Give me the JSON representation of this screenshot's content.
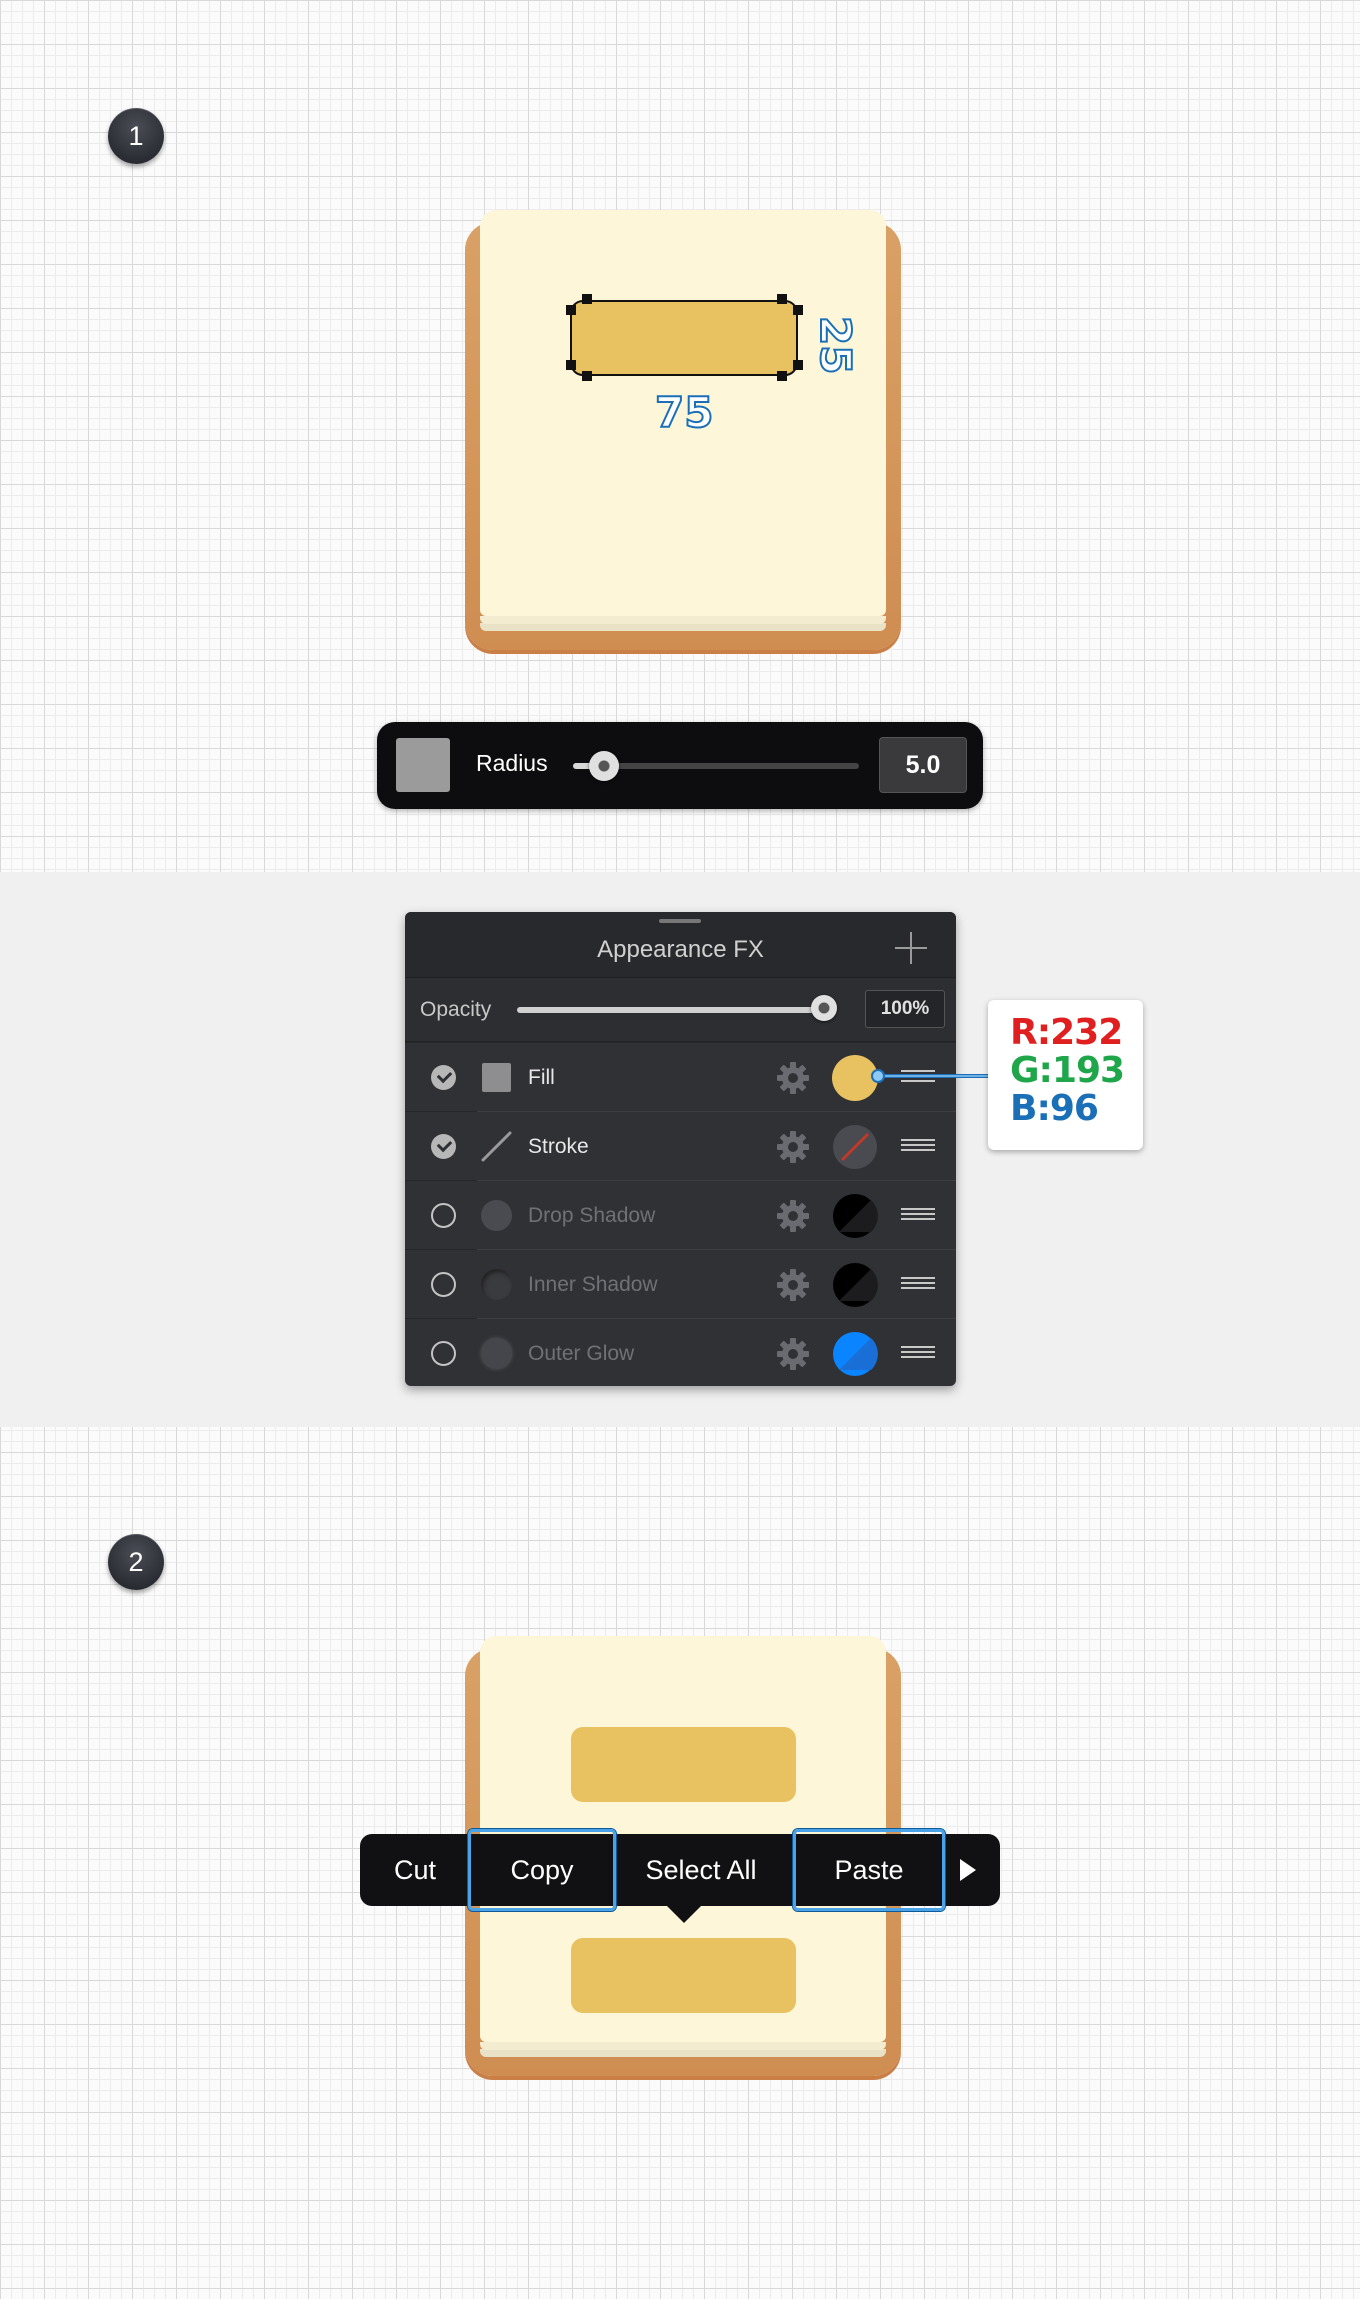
{
  "steps": [
    "1",
    "2"
  ],
  "dimensions": {
    "width": "75",
    "height": "25"
  },
  "radius_toolbar": {
    "label": "Radius",
    "value": "5.0",
    "slider_fraction": 0.08
  },
  "appearance_panel": {
    "title": "Appearance FX",
    "opacity_label": "Opacity",
    "opacity_value": "100%",
    "opacity_fraction": 1.0,
    "effects": [
      {
        "label": "Fill",
        "enabled": true,
        "color": "#e8c160"
      },
      {
        "label": "Stroke",
        "enabled": true,
        "color": "none"
      },
      {
        "label": "Drop Shadow",
        "enabled": false,
        "color": "#000000"
      },
      {
        "label": "Inner Shadow",
        "enabled": false,
        "color": "#000000"
      },
      {
        "label": "Outer Glow",
        "enabled": false,
        "color": "#0a84ff"
      }
    ]
  },
  "rgb_callout": {
    "r": "R:232",
    "g": "G:193",
    "b": "B:96"
  },
  "context_menu": {
    "items": [
      "Cut",
      "Copy",
      "Select All",
      "Paste"
    ],
    "highlighted": [
      "Copy",
      "Paste"
    ]
  },
  "colors": {
    "fill": "#e8c160",
    "paper": "#fdf6d8",
    "pad": "#d39656",
    "accent": "#4aa3e8"
  }
}
